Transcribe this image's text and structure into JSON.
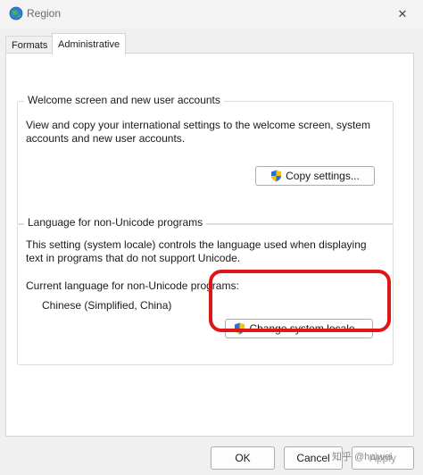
{
  "window": {
    "title": "Region"
  },
  "tabs": [
    {
      "label": "Formats"
    },
    {
      "label": "Administrative"
    }
  ],
  "welcome_group": {
    "title": "Welcome screen and new user accounts",
    "description": "View and copy your international settings to the welcome screen, system accounts and new user accounts.",
    "copy_button": "Copy settings..."
  },
  "unicode_group": {
    "title": "Language for non-Unicode programs",
    "description": "This setting (system locale) controls the language used when displaying text in programs that do not support Unicode.",
    "current_label": "Current language for non-Unicode programs:",
    "current_value": "Chinese (Simplified, China)",
    "change_button": "Change system locale..."
  },
  "footer": {
    "ok": "OK",
    "cancel": "Cancel",
    "apply": "Apply"
  },
  "watermark": "知乎 @huiwei",
  "colors": {
    "annotation": "#e01616",
    "shield_blue": "#2b6fd6",
    "shield_yellow": "#f5c400"
  },
  "icons": {
    "app": "globe-icon",
    "close": "close-icon",
    "uac": "uac-shield-icon"
  }
}
